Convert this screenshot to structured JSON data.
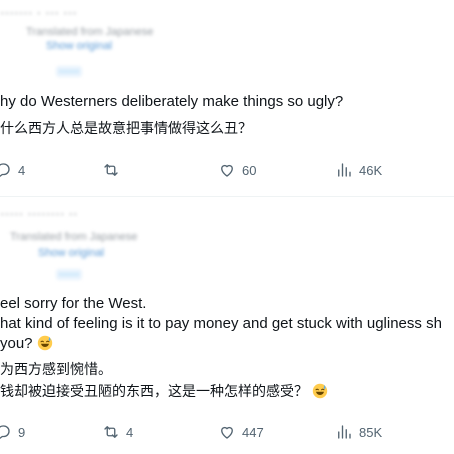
{
  "posts": [
    {
      "header": {
        "name": "······· · ··· ···",
        "handle": "",
        "translated_note": "Translated from Japanese",
        "show_original": "Show original",
        "tag": "······"
      },
      "lines": [
        "hy do Westerners deliberately make things so ugly?",
        "什么西方人总是故意把事情做得这么丑？"
      ],
      "stats": {
        "replies": "4",
        "reposts": "",
        "likes": "60",
        "views": "46K"
      }
    },
    {
      "header": {
        "name": "····· ········ ··",
        "translated_note": "Translated from Japanese",
        "show_original": "Show original",
        "tag": "······"
      },
      "lines": [
        "eel sorry for the West.",
        "hat kind of feeling is it to pay money and get stuck with ugliness sh",
        "you?",
        "为西方感到惋惜。",
        "钱却被迫接受丑陋的东西，这是一种怎样的感受？"
      ],
      "stats": {
        "replies": "9",
        "reposts": "4",
        "likes": "447",
        "views": "85K"
      }
    }
  ],
  "icons": {
    "reply": "reply-icon",
    "repost": "repost-icon",
    "like": "heart-icon",
    "views": "views-chart-icon",
    "emoji": "sweat-smile-emoji"
  },
  "colors": {
    "text": "#0f1419",
    "muted": "#536471",
    "link": "#1d9bf0",
    "divider": "#eff3f4"
  }
}
